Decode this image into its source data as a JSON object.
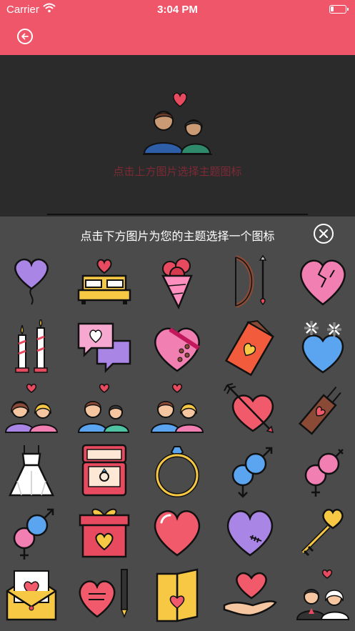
{
  "status_bar": {
    "carrier": "Carrier",
    "time": "3:04 PM"
  },
  "preview": {
    "hint": "点击上方图片选择主题图标"
  },
  "panel": {
    "title": "点击下方图片为您的主题选择一个图标"
  },
  "colors": {
    "header": "#f0566a",
    "panel": "#4b4b4b",
    "preview_bg": "#2b2b2b"
  },
  "icons": [
    "balloon-heart",
    "bed-heart",
    "bouquet",
    "bow-arrow",
    "broken-heart",
    "candles",
    "chat-heart",
    "chocolate-box",
    "chocolate-bar",
    "snow-heart",
    "couple-women",
    "couple-men",
    "couple",
    "arrow-heart",
    "quiver",
    "wedding-dress",
    "ring-box",
    "ring",
    "male-symbols",
    "female-symbols",
    "gender-symbols",
    "gift-box",
    "heart",
    "stitched-heart",
    "heart-key",
    "love-letter",
    "heart-pen",
    "card",
    "heart-hand",
    "wedding-couple"
  ]
}
